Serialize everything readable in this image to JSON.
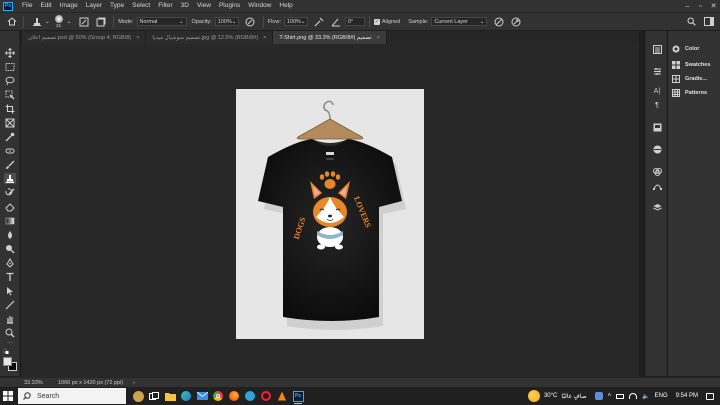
{
  "app": {
    "logo_text": "Ps"
  },
  "menu": {
    "items": [
      {
        "label": "File"
      },
      {
        "label": "Edit"
      },
      {
        "label": "Image"
      },
      {
        "label": "Layer"
      },
      {
        "label": "Type"
      },
      {
        "label": "Select"
      },
      {
        "label": "Filter"
      },
      {
        "label": "3D"
      },
      {
        "label": "View"
      },
      {
        "label": "Plugins"
      },
      {
        "label": "Window"
      },
      {
        "label": "Help"
      }
    ]
  },
  "options_bar": {
    "brush_size": "21",
    "mode_label": "Mode:",
    "mode_value": "Normal",
    "opacity_label": "Opacity:",
    "opacity_value": "100%",
    "flow_label": "Flow:",
    "flow_value": "100%",
    "angle_value": "0°",
    "aligned_label": "Aligned",
    "sample_label": "Sample:",
    "sample_value": "Current Layer"
  },
  "tabs": [
    {
      "label": "تصميم اعلان.psd @ 50% (Group 4, RGB/8)",
      "active": false
    },
    {
      "label": "تصميم سوشيال ميديا.jpg @ 12.5% (RGB/8#)",
      "active": false
    },
    {
      "label": "T-Shirt.png @ 33.3% (RGB/8#) تصميم",
      "active": true
    }
  ],
  "tab_close": "×",
  "toolbar": {
    "active_tool": "clone-stamp-tool"
  },
  "artwork": {
    "left_text": "DOGS",
    "right_text": "LOVERS",
    "brand_text": "SUSHI",
    "orange": "#e8862a",
    "shirt": "#141414"
  },
  "panels": [
    {
      "label": "Color"
    },
    {
      "label": "Swatches"
    },
    {
      "label": "Gradie..."
    },
    {
      "label": "Patterns"
    }
  ],
  "status": {
    "zoom": "33.33%",
    "document_size": "1066 px x 1420 px (72 ppi)"
  },
  "taskbar": {
    "search_placeholder": "Search",
    "temperature": "30°C",
    "weather_text": "صافٍ غالبًا",
    "language": "ENG",
    "time": "9:54 PM"
  },
  "colors": {
    "ui_bg": "#323232",
    "canvas_bg": "#282828",
    "active_tab": "#3b3b3b",
    "accent": "#31a8ff"
  }
}
